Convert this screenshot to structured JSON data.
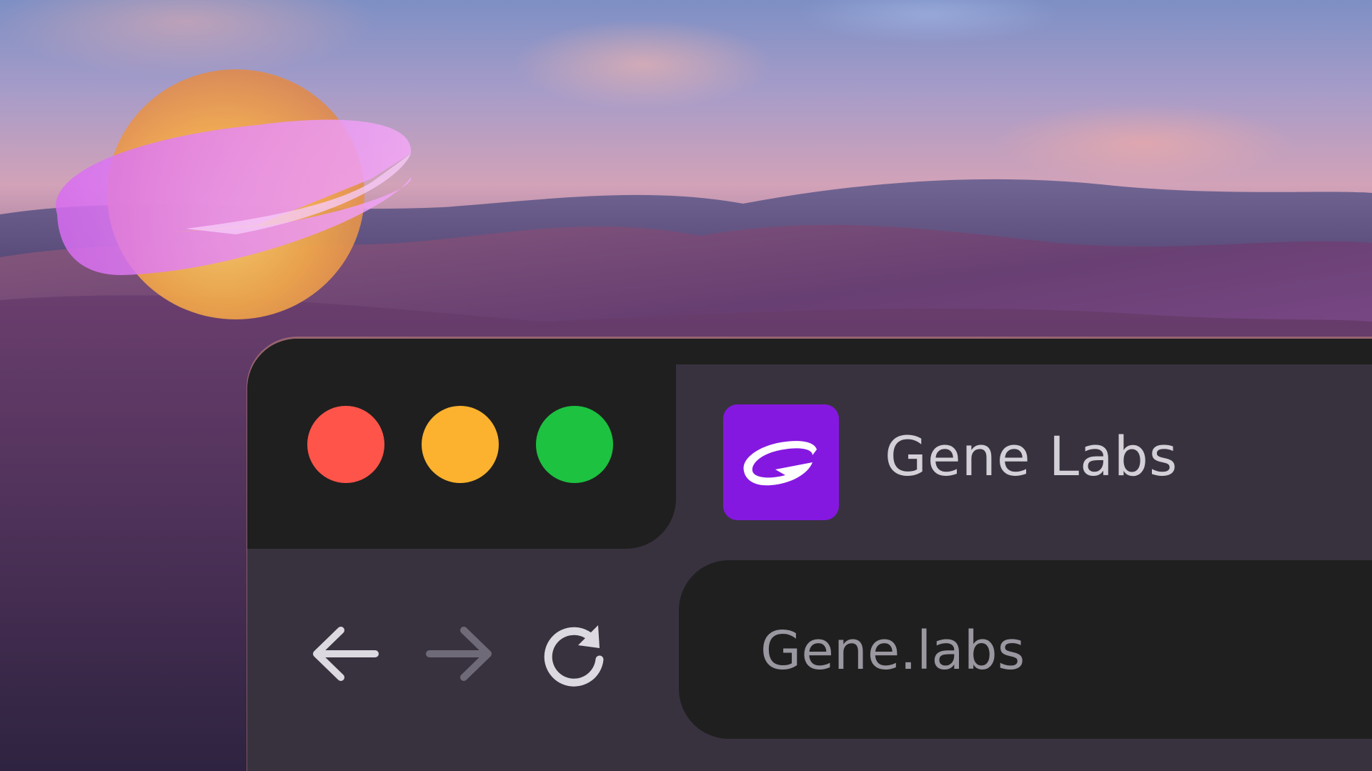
{
  "window": {
    "traffic_lights": [
      {
        "name": "close",
        "color": "#ff5449"
      },
      {
        "name": "minimize",
        "color": "#fcb22e"
      },
      {
        "name": "zoom",
        "color": "#1cc240"
      }
    ]
  },
  "tab": {
    "title": "Gene Labs",
    "favicon": "gene-labs-logo-icon",
    "favicon_bg": "#8518e0"
  },
  "navigation": {
    "back_icon": "arrow-left-icon",
    "forward_icon": "arrow-right-icon",
    "reload_icon": "reload-icon",
    "forward_enabled": false
  },
  "address_bar": {
    "url": "Gene.labs"
  },
  "colors": {
    "window_dark": "#1f1f1f",
    "window_panel": "#38323f",
    "accent": "#8518e0",
    "text_primary": "#d3d0d8",
    "text_muted": "#9a97a0"
  }
}
